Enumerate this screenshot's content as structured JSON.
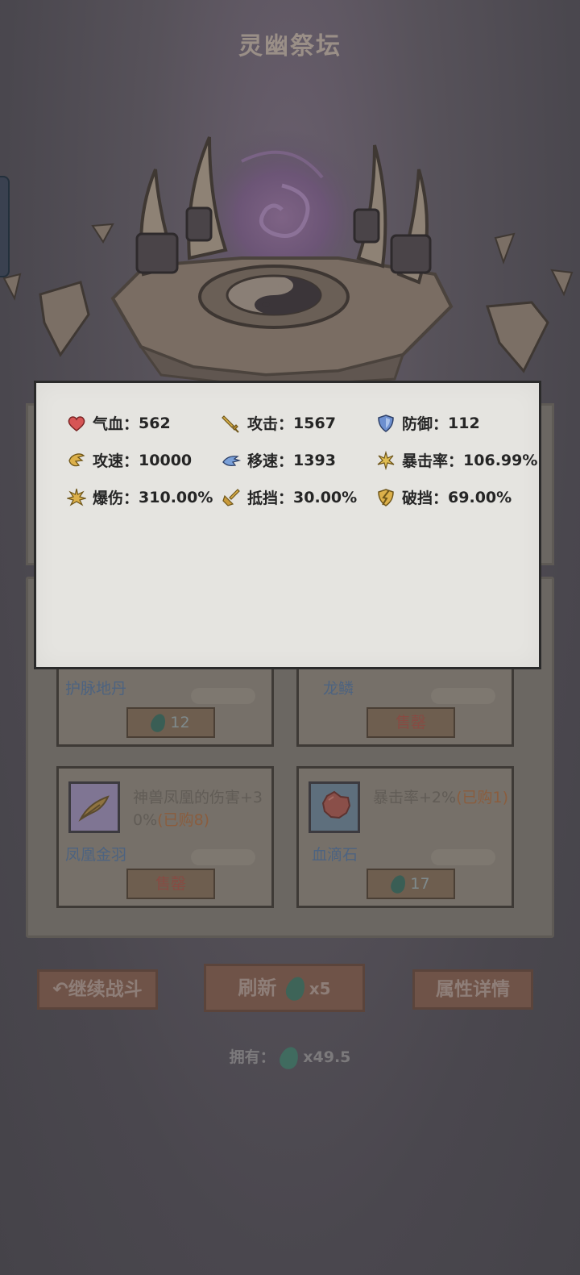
{
  "title": "灵幽祭坛",
  "stats": [
    {
      "label": "气血",
      "value": "562",
      "icon": "heart-icon"
    },
    {
      "label": "攻击",
      "value": "1567",
      "icon": "sword-icon"
    },
    {
      "label": "防御",
      "value": "112",
      "icon": "shield-icon"
    },
    {
      "label": "攻速",
      "value": "10000",
      "icon": "attack-speed-icon"
    },
    {
      "label": "移速",
      "value": "1393",
      "icon": "move-speed-icon"
    },
    {
      "label": "暴击率",
      "value": "106.99%",
      "icon": "crit-rate-icon"
    },
    {
      "label": "爆伤",
      "value": "310.00%",
      "icon": "crit-damage-icon"
    },
    {
      "label": "抵挡",
      "value": "30.00%",
      "icon": "block-icon"
    },
    {
      "label": "破挡",
      "value": "69.00%",
      "icon": "block-break-icon"
    }
  ],
  "separator": "：",
  "shop": {
    "items": [
      {
        "name": "护脉地丹",
        "button": "12",
        "button_type": "price"
      },
      {
        "name": "龙鳞",
        "button": "售罄",
        "button_type": "sold"
      },
      {
        "name": "凤凰金羽",
        "desc": "神兽凤凰的伤害+30%",
        "bought": "(已购8)",
        "button": "售罄",
        "button_type": "sold",
        "icon": "phoenix-feather-icon"
      },
      {
        "name": "血滴石",
        "desc": "暴击率+2%",
        "bought": "(已购1)",
        "button": "17",
        "button_type": "price",
        "icon": "blood-stone-icon"
      }
    ]
  },
  "buttons": {
    "continue": "继续战斗",
    "refresh": "刷新",
    "refresh_cost": "x5",
    "details": "属性详情"
  },
  "owned": {
    "label": "拥有：",
    "value": "x49.5"
  },
  "colors": {
    "popup_bg": "#e5e4e0",
    "background": "#4e4b52",
    "button_bg": "#6f5348"
  }
}
